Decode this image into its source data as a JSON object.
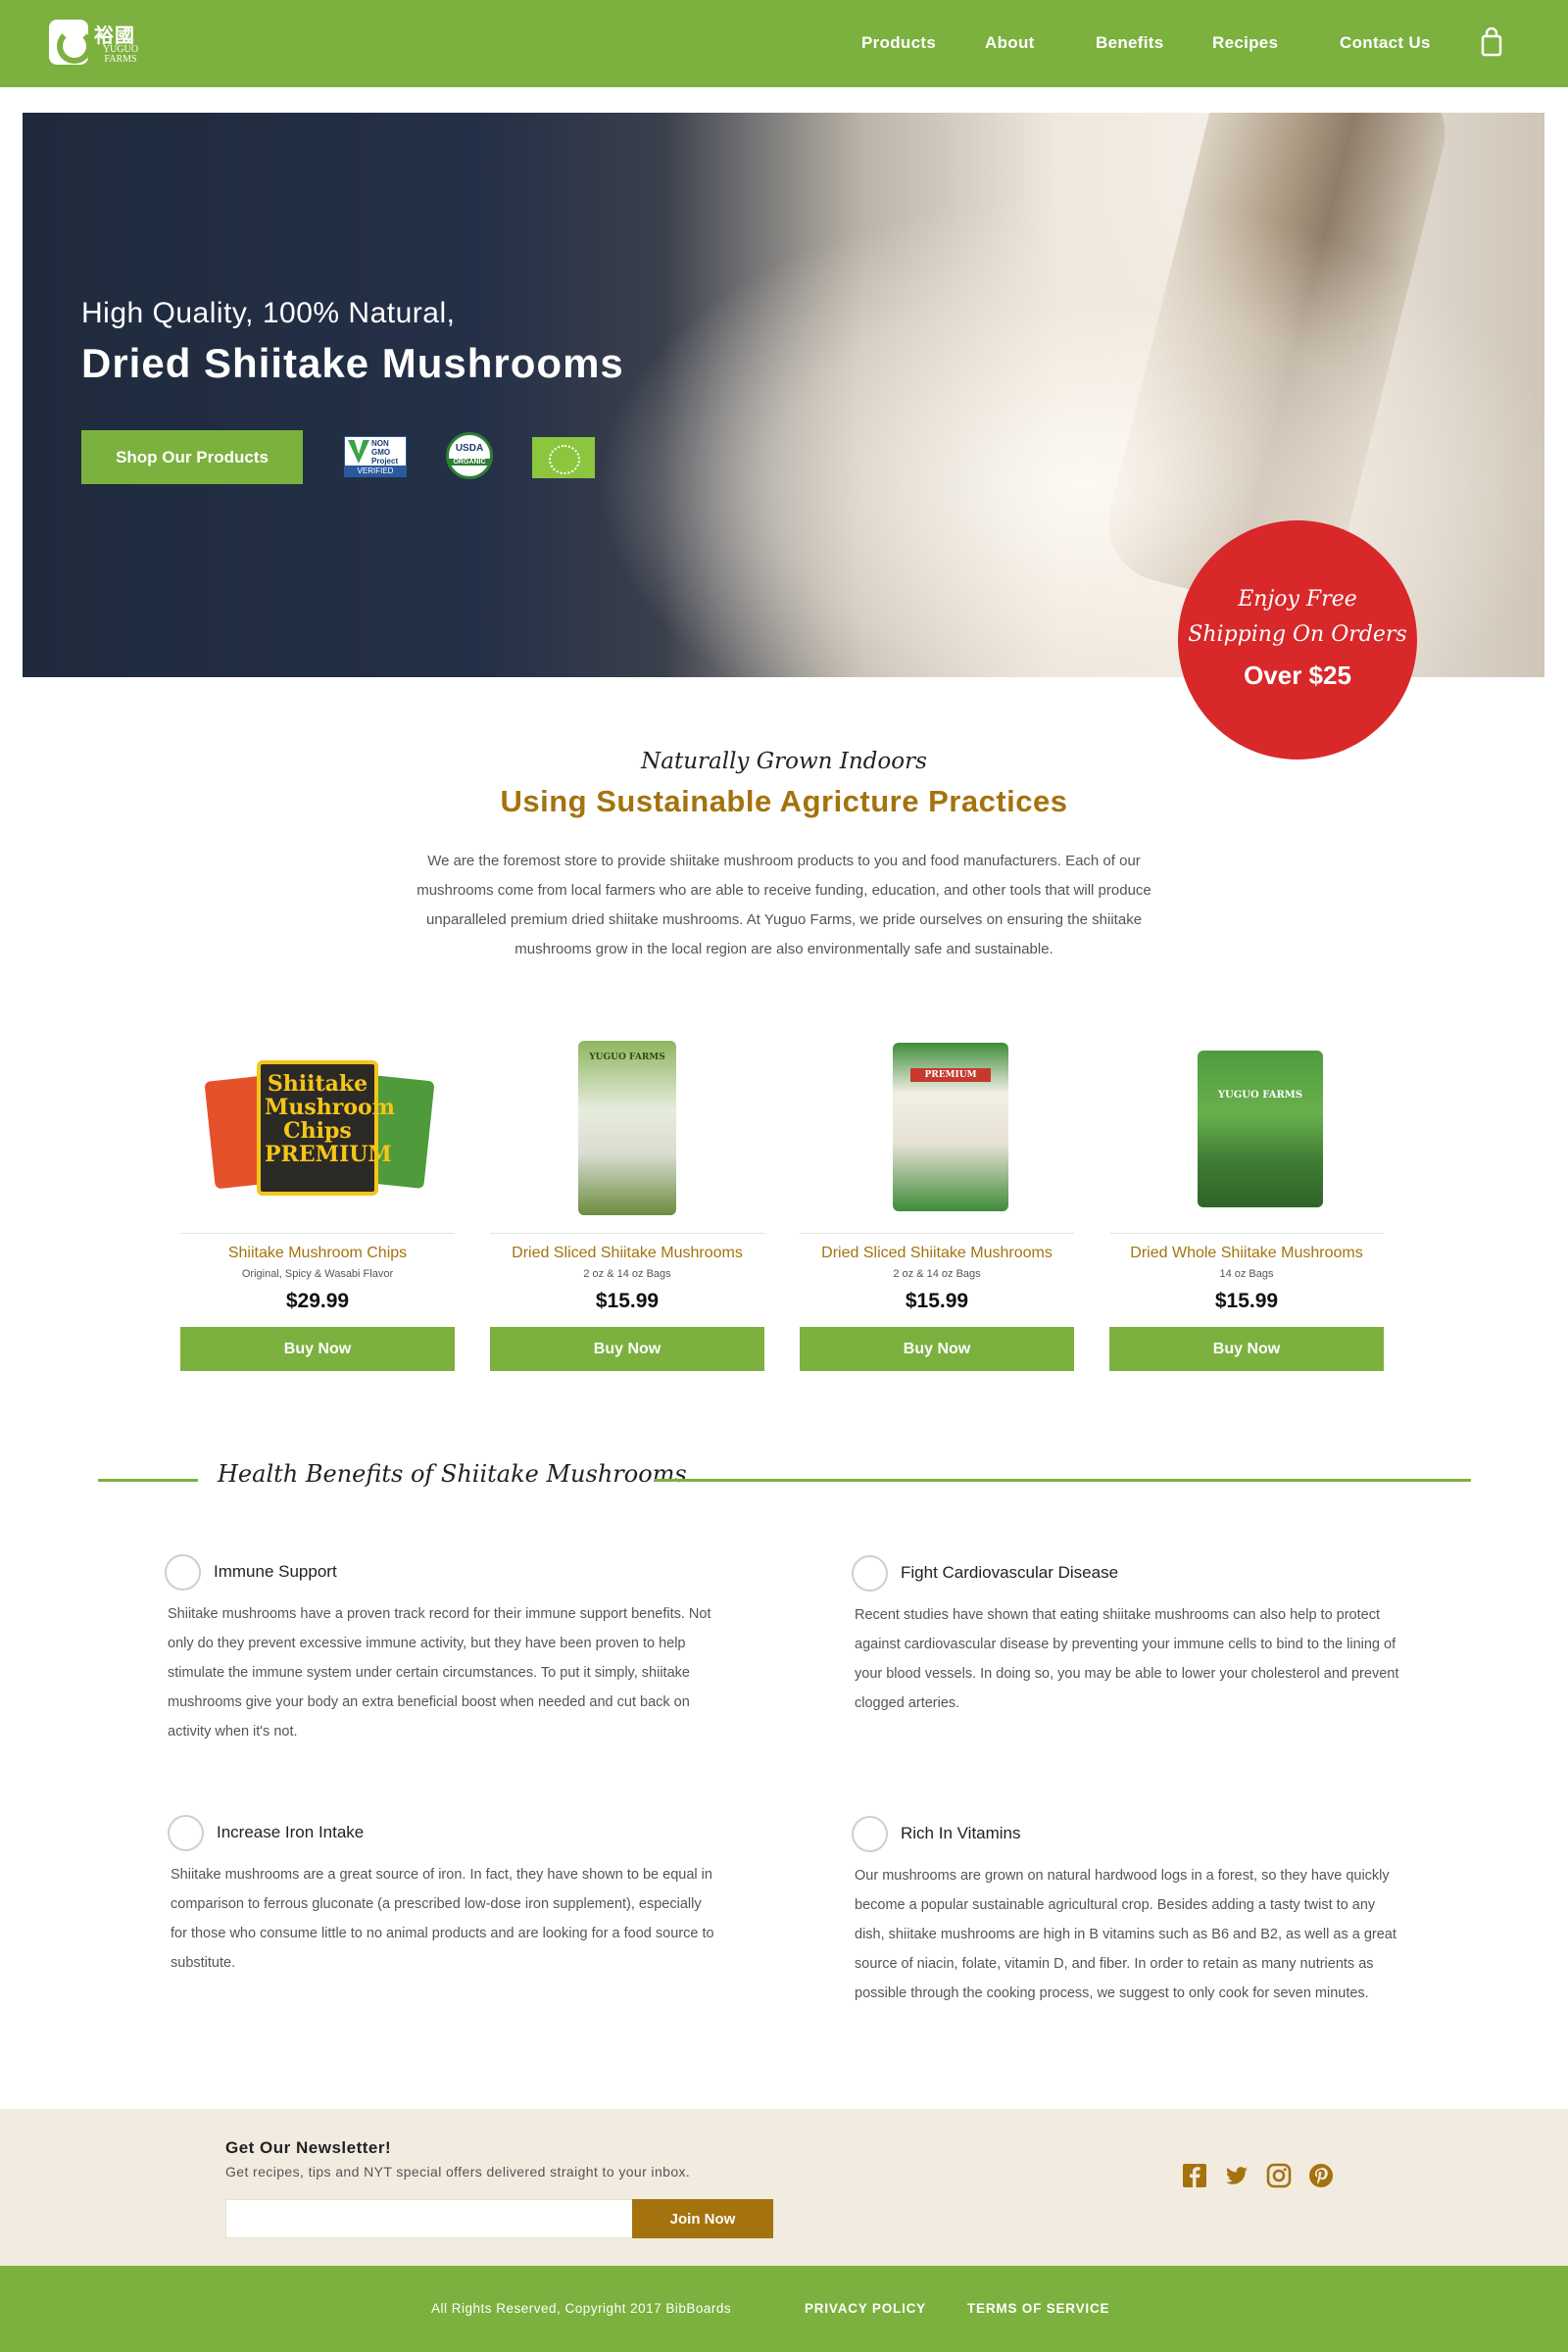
{
  "header": {
    "logo_cn": "裕國",
    "logo_en_line1": "YUGUO",
    "logo_en_line2": "FARMS",
    "nav": [
      "Products",
      "About",
      "Benefits",
      "Recipes",
      "Contact Us"
    ],
    "cart_icon": "shopping-bag-icon"
  },
  "hero": {
    "subtitle": "High Quality, 100% Natural,",
    "title": "Dried Shiitake Mushrooms",
    "cta": "Shop Our Products",
    "badges": {
      "nongmo_top": "NON GMO Project",
      "nongmo_bottom": "VERIFIED",
      "usda_top": "USDA",
      "usda_bottom": "ORGANIC"
    },
    "promo": {
      "line1": "Enjoy Free",
      "line2": "Shipping On Orders",
      "line3": "Over $25"
    }
  },
  "intro": {
    "script": "Naturally Grown Indoors",
    "title": "Using Sustainable Agricture Practices",
    "body": "We are the foremost store to provide shiitake mushroom products to you and food manufacturers. Each of our mushrooms come from local farmers who are able to receive funding, education, and other tools that will produce unparalleled premium dried shiitake mushrooms. At Yuguo Farms, we pride ourselves on ensuring the shiitake mushrooms grow in the local region are also environmentally safe and sustainable."
  },
  "products": [
    {
      "name": "Shiitake Mushroom Chips",
      "sub": "Original, Spicy & Wasabi Flavor",
      "price": "$29.99",
      "button": "Buy Now",
      "pack_text": "Shiitake Mushroom Chips PREMIUM"
    },
    {
      "name": "Dried Sliced Shiitake Mushrooms",
      "sub": "2 oz & 14 oz Bags",
      "price": "$15.99",
      "button": "Buy Now",
      "pack_text": "YUGUO FARMS"
    },
    {
      "name": "Dried Sliced Shiitake Mushrooms",
      "sub": "2 oz & 14 oz Bags",
      "price": "$15.99",
      "button": "Buy Now",
      "pack_text": "PREMIUM"
    },
    {
      "name": "Dried Whole Shiitake Mushrooms",
      "sub": "14 oz Bags",
      "price": "$15.99",
      "button": "Buy Now",
      "pack_text": "YUGUO FARMS"
    }
  ],
  "benefits": {
    "heading": "Health Benefits of Shiitake Mushrooms",
    "items": [
      {
        "title": "Immune Support",
        "body": "Shiitake mushrooms have a proven track record for their immune support benefits. Not only do they prevent excessive immune activity, but they have been proven to help stimulate the immune system under certain circumstances. To put it simply, shiitake mushrooms give your body an extra beneficial boost when needed and cut back on activity when it's not."
      },
      {
        "title": "Fight Cardiovascular Disease",
        "body": "Recent studies have shown that eating shiitake mushrooms can also help to protect against cardiovascular disease by preventing your immune cells to bind to the lining of your blood vessels. In doing so, you may be able to lower your cholesterol and prevent clogged arteries."
      },
      {
        "title": "Increase Iron Intake",
        "body": "Shiitake mushrooms are a great source of iron. In fact, they have shown to be equal in comparison to ferrous gluconate (a prescribed low-dose iron supplement), especially for those who consume little to no animal products and are looking for a food source to substitute."
      },
      {
        "title": "Rich In Vitamins",
        "body": "Our mushrooms are grown on natural hardwood logs in a forest, so they have quickly become a popular sustainable agricultural crop. Besides adding a tasty twist to any dish, shiitake mushrooms are high in B vitamins such as B6 and B2, as well as a great source of niacin, folate, vitamin D, and fiber. In order to retain as many nutrients as possible through the cooking process, we suggest to only cook for seven minutes."
      }
    ]
  },
  "newsletter": {
    "title": "Get Our Newsletter!",
    "subtitle": "Get recipes, tips and NYT special offers delivered straight to your inbox.",
    "input_value": "",
    "button": "Join Now",
    "social_icons": [
      "facebook-icon",
      "twitter-icon",
      "instagram-icon",
      "pinterest-icon"
    ]
  },
  "footer": {
    "copyright": "All Rights Reserved, Copyright 2017 BibBoards",
    "privacy": "PRIVACY POLICY",
    "terms": "TERMS OF SERVICE"
  },
  "colors": {
    "brand_green": "#7cb13f",
    "gold": "#a4730e",
    "promo_red": "#d8282a",
    "newsletter_bg": "#f2ebe0"
  }
}
